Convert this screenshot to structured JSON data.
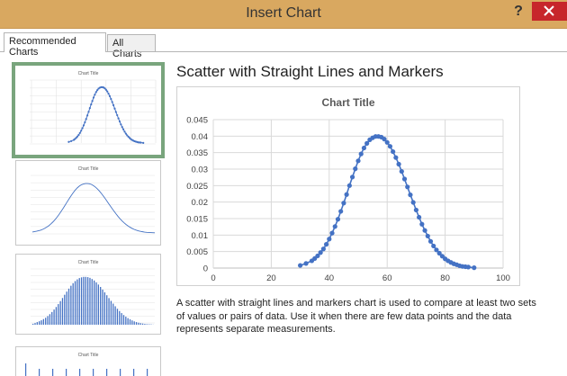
{
  "window": {
    "title": "Insert Chart",
    "help_label": "?"
  },
  "tabs": [
    {
      "label": "Recommended Charts",
      "active": true
    },
    {
      "label": "All Charts",
      "active": false
    }
  ],
  "thumbnails": [
    {
      "kind": "scatter-lines-markers",
      "title": "Chart Title",
      "selected": true
    },
    {
      "kind": "scatter-smooth-line",
      "title": "Chart Title",
      "selected": false
    },
    {
      "kind": "column",
      "title": "Chart Title",
      "selected": false
    },
    {
      "kind": "column-partial",
      "title": "Chart Title",
      "selected": false
    }
  ],
  "preview": {
    "heading": "Scatter with Straight Lines and Markers",
    "description": "A scatter with straight lines and markers chart is used to compare at least two sets of values or pairs of data.  Use it when there are few data points and the data represents separate measurements."
  },
  "colors": {
    "titlebar": "#d9a860",
    "close": "#c7262b",
    "series": "#4472c4",
    "selected_border": "#79a57d",
    "gridline": "#d9d9d9"
  },
  "chart_data": {
    "type": "scatter",
    "title": "Chart Title",
    "xlabel": "",
    "ylabel": "",
    "xlim": [
      0,
      100
    ],
    "ylim": [
      0,
      0.045
    ],
    "xticks": [
      "0",
      "20",
      "40",
      "60",
      "80",
      "100"
    ],
    "yticks": [
      "0",
      "0.005",
      "0.01",
      "0.015",
      "0.02",
      "0.025",
      "0.03",
      "0.035",
      "0.04",
      "0.045"
    ],
    "grid": true,
    "series": [
      {
        "x": [
          30,
          32,
          34,
          35,
          36,
          37,
          38,
          39,
          40,
          41,
          42,
          43,
          44,
          45,
          46,
          47,
          48,
          49,
          50,
          51,
          52,
          53,
          54,
          55,
          56,
          57,
          58,
          59,
          60,
          61,
          62,
          63,
          64,
          65,
          66,
          67,
          68,
          69,
          70,
          71,
          72,
          73,
          74,
          75,
          76,
          77,
          78,
          79,
          80,
          81,
          82,
          83,
          84,
          85,
          86,
          87,
          88,
          90
        ],
        "y": [
          0.0008,
          0.0014,
          0.0022,
          0.0029,
          0.0037,
          0.0047,
          0.0058,
          0.0072,
          0.0088,
          0.0106,
          0.0126,
          0.0148,
          0.0172,
          0.0197,
          0.0223,
          0.025,
          0.0276,
          0.0301,
          0.0325,
          0.0346,
          0.0364,
          0.0378,
          0.0389,
          0.0395,
          0.0399,
          0.0399,
          0.0397,
          0.0391,
          0.0381,
          0.0369,
          0.0353,
          0.0335,
          0.0315,
          0.0293,
          0.027,
          0.0246,
          0.0222,
          0.0199,
          0.0176,
          0.0154,
          0.0133,
          0.0114,
          0.0097,
          0.0081,
          0.0067,
          0.0055,
          0.0045,
          0.0036,
          0.0028,
          0.0022,
          0.0017,
          0.0013,
          0.001,
          0.0007,
          0.0005,
          0.0004,
          0.0003,
          0.0001
        ]
      }
    ]
  }
}
